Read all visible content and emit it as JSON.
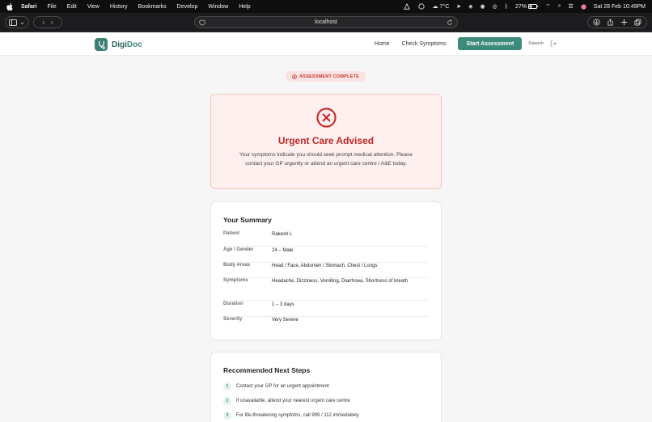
{
  "menubar": {
    "app": "Safari",
    "menus": [
      "File",
      "Edit",
      "View",
      "History",
      "Bookmarks",
      "Develop",
      "Window",
      "Help"
    ],
    "temperature": "7°C",
    "battery": "27%",
    "datetime": "Sat 28 Feb  10:49PM"
  },
  "browser": {
    "url": "localhost"
  },
  "nav": {
    "logo_part1": "Digi",
    "logo_part2": "Doc",
    "links": [
      "Home",
      "Check Symptoms"
    ],
    "cta": "Start Assessment",
    "user": "Rakesh"
  },
  "badge": "ASSESSMENT COMPLETE",
  "alert": {
    "title": "Urgent Care Advised",
    "message": "Your symptoms indicate you should seek prompt medical attention. Please contact your GP urgently or attend an urgent care centre / A&E today."
  },
  "summary": {
    "title": "Your Summary",
    "rows": [
      {
        "label": "Patient",
        "value": "Rakesh L"
      },
      {
        "label": "Age / Gender",
        "value": "24 – Male"
      },
      {
        "label": "Body Areas",
        "value": "Head / Face, Abdomen / Stomach, Chest / Lungs"
      },
      {
        "label": "Symptoms",
        "value": "Headache, Dizziness, Vomiting, Diarrhoea, Shortness of breath"
      },
      {
        "label": "Duration",
        "value": "1 – 3 days"
      },
      {
        "label": "Severity",
        "value": "Very Severe"
      }
    ]
  },
  "steps": {
    "title": "Recommended Next Steps",
    "items": [
      {
        "num": "1",
        "text": "Contact your GP for an urgent appointment"
      },
      {
        "num": "2",
        "text": "If unavailable, attend your nearest urgent care centre"
      },
      {
        "num": "3",
        "text": "For life-threatening symptoms, call 999 / 112 immediately"
      }
    ]
  },
  "colors": {
    "brand": "#3d8b7d",
    "urgent": "#c62828",
    "alert_bg": "#fdf0ee"
  }
}
